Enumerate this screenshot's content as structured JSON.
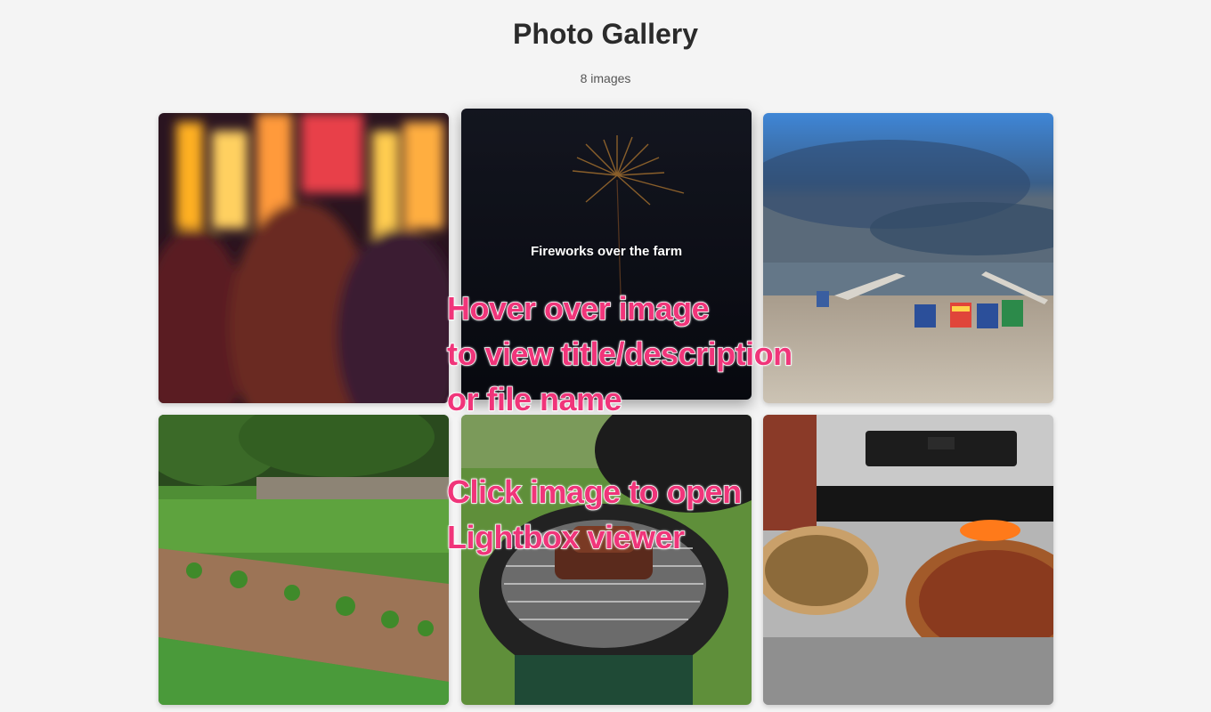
{
  "gallery": {
    "title": "Photo Gallery",
    "count_label": "8 images"
  },
  "tiles": [
    {
      "name": "blurred-lights-crowd"
    },
    {
      "name": "fireworks",
      "caption": "Fireworks over the farm"
    },
    {
      "name": "beach-lake"
    },
    {
      "name": "garden-rows"
    },
    {
      "name": "grill-ribs"
    },
    {
      "name": "pizzas-oven"
    }
  ],
  "annotations": {
    "hover": [
      "Hover over image",
      "to view title/description",
      "or file name"
    ],
    "click": [
      "Click image to open",
      "Lightbox viewer"
    ]
  },
  "colors": {
    "background": "#f4f4f4",
    "annotation": "#f0357a"
  }
}
